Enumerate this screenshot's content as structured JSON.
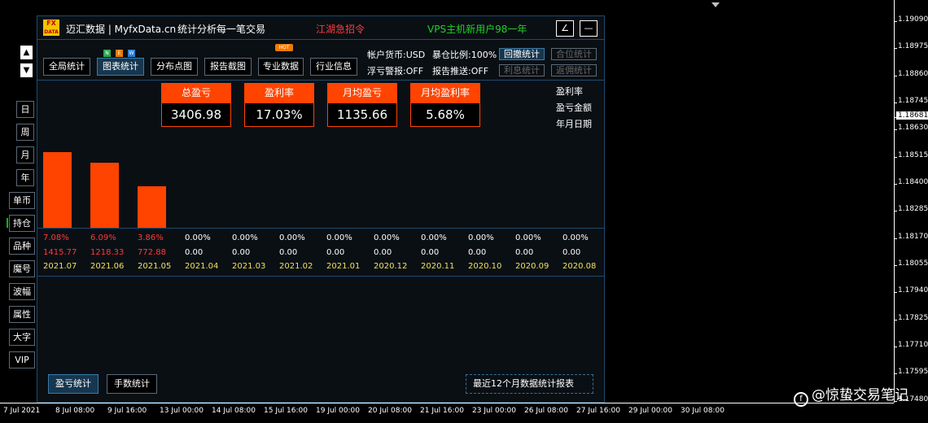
{
  "header": {
    "app_name": "迈汇数据 | MyfxData.cn",
    "slogan": "统计分析每一笔交易",
    "promo_red": "江湖急招令",
    "promo_green": "VPS主机新用户98一年",
    "logo_top": "FX",
    "logo_bottom": "DATA",
    "edit_icon": "∠",
    "minimize_icon": "—"
  },
  "nav_arrows": {
    "up": "▲",
    "down": "▼"
  },
  "sidebar": {
    "items": [
      "日",
      "周",
      "月",
      "年",
      "单币",
      "持仓",
      "品种",
      "魔号",
      "波幅",
      "属性",
      "大字",
      "VIP"
    ]
  },
  "tabs": [
    {
      "label": "全局统计",
      "active": false
    },
    {
      "label": "图表统计",
      "active": true
    },
    {
      "label": "分布点图",
      "active": false
    },
    {
      "label": "报告截图",
      "active": false
    },
    {
      "label": "专业数据",
      "active": false
    },
    {
      "label": "行业信息",
      "active": false
    }
  ],
  "badges": {
    "n": "N",
    "e": "E",
    "w": "W",
    "hot": "HOT"
  },
  "account": {
    "currency": "帐户货币:USD",
    "ratio": "暴仓比例:100%",
    "float_alert": "浮亏警报:OFF",
    "report_push": "报告推送:OFF",
    "btn_withdraw": "回撤统计",
    "btn_position": "合位统计",
    "btn_interest": "利息统计",
    "btn_rebate": "返佣统计"
  },
  "stats": [
    {
      "label": "总盈亏",
      "value": "3406.98"
    },
    {
      "label": "盈利率",
      "value": "17.03%"
    },
    {
      "label": "月均盈亏",
      "value": "1135.66"
    },
    {
      "label": "月均盈利率",
      "value": "5.68%"
    }
  ],
  "legend": [
    "盈利率",
    "盈亏金额",
    "年月日期"
  ],
  "chart_data": {
    "type": "bar",
    "categories": [
      "2021.07",
      "2021.06",
      "2021.05",
      "2021.04",
      "2021.03",
      "2021.02",
      "2021.01",
      "2020.12",
      "2020.11",
      "2020.10",
      "2020.09",
      "2020.08"
    ],
    "rate_labels": [
      "7.08%",
      "6.09%",
      "3.86%",
      "0.00%",
      "0.00%",
      "0.00%",
      "0.00%",
      "0.00%",
      "0.00%",
      "0.00%",
      "0.00%",
      "0.00%"
    ],
    "amount_labels": [
      "1415.77",
      "1218.33",
      "772.88",
      "0.00",
      "0.00",
      "0.00",
      "0.00",
      "0.00",
      "0.00",
      "0.00",
      "0.00",
      "0.00"
    ],
    "values": [
      7.08,
      6.09,
      3.86,
      0,
      0,
      0,
      0,
      0,
      0,
      0,
      0,
      0
    ],
    "ylim": [
      0,
      8.2
    ],
    "colors": {
      "bar": "#ff4400",
      "positive_text": "#ff3b3b",
      "zero_text": "#ffffff",
      "date_text": "#f0e060"
    }
  },
  "bottom": {
    "btn_profit": "盈亏统计",
    "btn_lots": "手数统计",
    "note": "最近12个月数据统计报表"
  },
  "price_axis": {
    "labels": [
      "1.19090",
      "1.18975",
      "1.18860",
      "1.18745",
      "1.18681",
      "1.18630",
      "1.18515",
      "1.18400",
      "1.18285",
      "1.18170",
      "1.18055",
      "1.17940",
      "1.17825",
      "1.17710",
      "1.17595",
      "1.17480"
    ],
    "current": "1.18681"
  },
  "time_axis": {
    "labels": [
      "7 Jul 2021",
      "8 Jul 08:00",
      "9 Jul 16:00",
      "13 Jul 00:00",
      "14 Jul 08:00",
      "15 Jul 16:00",
      "19 Jul 00:00",
      "20 Jul 08:00",
      "21 Jul 16:00",
      "23 Jul 00:00",
      "26 Jul 08:00",
      "27 Jul 16:00",
      "29 Jul 00:00",
      "30 Jul 08:00"
    ]
  },
  "watermark": "@惊蛰交易笔记"
}
